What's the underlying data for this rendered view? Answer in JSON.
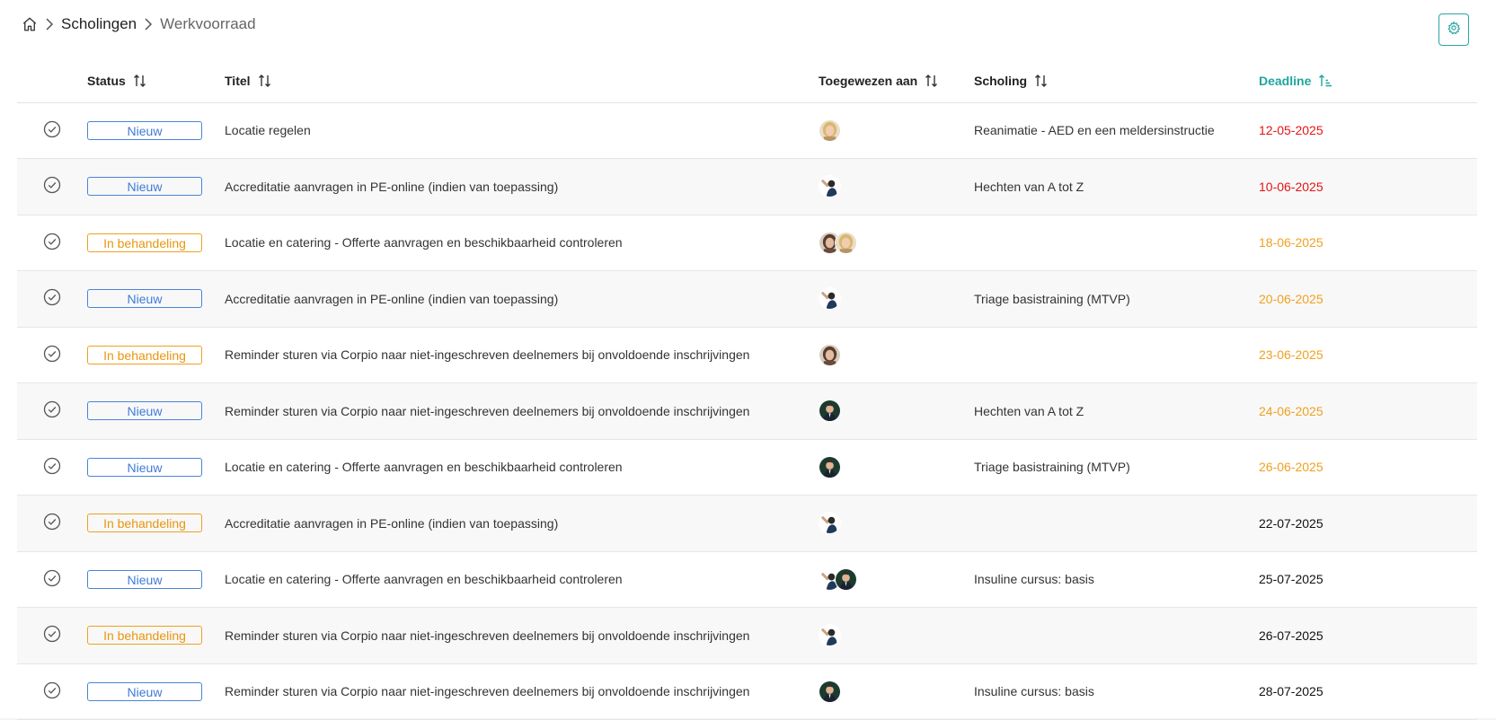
{
  "breadcrumb": {
    "home_icon": "home-icon",
    "items": [
      "Scholingen",
      "Werkvoorraad"
    ]
  },
  "settings_icon": "gear-icon",
  "colors": {
    "accent": "#1fa5a0",
    "status_new": "#3f7bd6",
    "status_in_progress": "#e8960e",
    "deadline_overdue": "#e51515",
    "deadline_soon": "#f0a020"
  },
  "table": {
    "columns": {
      "status": "Status",
      "titel": "Titel",
      "toegewezen": "Toegewezen aan",
      "scholing": "Scholing",
      "deadline": "Deadline"
    },
    "sorted_by": "Deadline",
    "rows": [
      {
        "status": "Nieuw",
        "title": "Locatie regelen",
        "assignees": [
          "blond"
        ],
        "scholing": "Reanimatie - AED en een meldersinstructie",
        "deadline": "12-05-2025",
        "deadline_state": "overdue"
      },
      {
        "status": "Nieuw",
        "title": "Accreditatie aanvragen in PE-online (indien van toepassing)",
        "assignees": [
          "arm"
        ],
        "scholing": "Hechten van A tot Z",
        "deadline": "10-06-2025",
        "deadline_state": "overdue"
      },
      {
        "status": "In behandeling",
        "title": "Locatie en catering - Offerte aanvragen en beschikbaarheid controleren",
        "assignees": [
          "brunette",
          "blond"
        ],
        "scholing": "",
        "deadline": "18-06-2025",
        "deadline_state": "soon"
      },
      {
        "status": "Nieuw",
        "title": "Accreditatie aanvragen in PE-online (indien van toepassing)",
        "assignees": [
          "arm"
        ],
        "scholing": "Triage basistraining (MTVP)",
        "deadline": "20-06-2025",
        "deadline_state": "soon"
      },
      {
        "status": "In behandeling",
        "title": "Reminder sturen via Corpio naar niet-ingeschreven deelnemers bij onvoldoende inschrijvingen",
        "assignees": [
          "brunette"
        ],
        "scholing": "",
        "deadline": "23-06-2025",
        "deadline_state": "soon"
      },
      {
        "status": "Nieuw",
        "title": "Reminder sturen via Corpio naar niet-ingeschreven deelnemers bij onvoldoende inschrijvingen",
        "assignees": [
          "suit"
        ],
        "scholing": "Hechten van A tot Z",
        "deadline": "24-06-2025",
        "deadline_state": "soon"
      },
      {
        "status": "Nieuw",
        "title": "Locatie en catering - Offerte aanvragen en beschikbaarheid controleren",
        "assignees": [
          "suit"
        ],
        "scholing": "Triage basistraining (MTVP)",
        "deadline": "26-06-2025",
        "deadline_state": "soon"
      },
      {
        "status": "In behandeling",
        "title": "Accreditatie aanvragen in PE-online (indien van toepassing)",
        "assignees": [
          "arm"
        ],
        "scholing": "",
        "deadline": "22-07-2025",
        "deadline_state": "normal"
      },
      {
        "status": "Nieuw",
        "title": "Locatie en catering - Offerte aanvragen en beschikbaarheid controleren",
        "assignees": [
          "arm",
          "suit"
        ],
        "scholing": "Insuline cursus: basis",
        "deadline": "25-07-2025",
        "deadline_state": "normal"
      },
      {
        "status": "In behandeling",
        "title": "Reminder sturen via Corpio naar niet-ingeschreven deelnemers bij onvoldoende inschrijvingen",
        "assignees": [
          "arm"
        ],
        "scholing": "",
        "deadline": "26-07-2025",
        "deadline_state": "normal"
      },
      {
        "status": "Nieuw",
        "title": "Reminder sturen via Corpio naar niet-ingeschreven deelnemers bij onvoldoende inschrijvingen",
        "assignees": [
          "suit"
        ],
        "scholing": "Insuline cursus: basis",
        "deadline": "28-07-2025",
        "deadline_state": "normal"
      }
    ]
  }
}
